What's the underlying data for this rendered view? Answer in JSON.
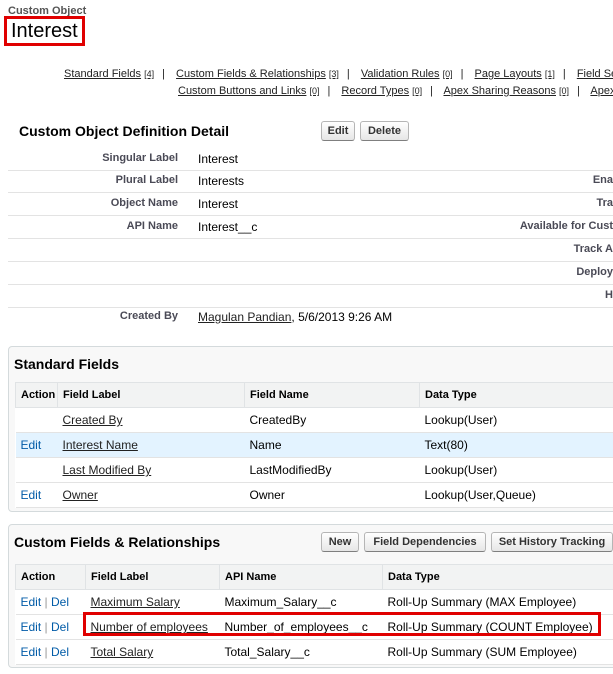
{
  "header": {
    "object_type": "Custom Object",
    "object_name": "Interest"
  },
  "related_links": {
    "row1": [
      {
        "label": "Standard Fields",
        "count": "[4]"
      },
      {
        "label": "Custom Fields & Relationships",
        "count": "[3]"
      },
      {
        "label": "Validation Rules",
        "count": "[0]"
      },
      {
        "label": "Page Layouts",
        "count": "[1]"
      },
      {
        "label": "Field Sets",
        "count": ""
      }
    ],
    "row2": [
      {
        "label": "Custom Buttons and Links",
        "count": "[0]"
      },
      {
        "label": "Record Types",
        "count": "[0]"
      },
      {
        "label": "Apex Sharing Reasons",
        "count": "[0]"
      },
      {
        "label": "Apex",
        "count": ""
      }
    ]
  },
  "definition": {
    "title": "Custom Object Definition Detail",
    "edit_label": "Edit",
    "delete_label": "Delete",
    "rows": [
      {
        "label": "Singular Label",
        "value": "Interest",
        "right_label": ""
      },
      {
        "label": "Plural Label",
        "value": "Interests",
        "right_label": "Ena"
      },
      {
        "label": "Object Name",
        "value": "Interest",
        "right_label": "Tra"
      },
      {
        "label": "API Name",
        "value": "Interest__c",
        "right_label": "Available for Cust"
      },
      {
        "label": "",
        "value": "",
        "right_label": "Track A"
      },
      {
        "label": "",
        "value": "",
        "right_label": "Deploy"
      },
      {
        "label": "",
        "value": "",
        "right_label": "H"
      }
    ],
    "created_by": {
      "label": "Created By",
      "user": "Magulan Pandian",
      "date": ", 5/6/2013 9:26 AM"
    }
  },
  "standard_fields": {
    "title": "Standard Fields",
    "columns": [
      "Action",
      "Field Label",
      "Field Name",
      "Data Type"
    ],
    "rows": [
      {
        "action": "",
        "field_label": "Created By",
        "field_name": "CreatedBy",
        "data_type": "Lookup(User)"
      },
      {
        "action": "Edit",
        "field_label": "Interest Name",
        "field_name": "Name",
        "data_type": "Text(80)"
      },
      {
        "action": "",
        "field_label": "Last Modified By",
        "field_name": "LastModifiedBy",
        "data_type": "Lookup(User)"
      },
      {
        "action": "Edit",
        "field_label": "Owner",
        "field_name": "Owner",
        "data_type": "Lookup(User,Queue)"
      }
    ]
  },
  "custom_fields": {
    "title": "Custom Fields & Relationships",
    "buttons": {
      "new": "New",
      "field_dependencies": "Field Dependencies",
      "history": "Set History Tracking"
    },
    "columns": [
      "Action",
      "Field Label",
      "API Name",
      "Data Type"
    ],
    "action_edit": "Edit",
    "action_sep": "|",
    "action_del": "Del",
    "rows": [
      {
        "field_label": "Maximum Salary",
        "api_name": "Maximum_Salary__c",
        "data_type": "Roll-Up Summary (MAX Employee)"
      },
      {
        "field_label": "Number of employees",
        "api_name": "Number_of_employees__c",
        "data_type": "Roll-Up Summary (COUNT Employee)"
      },
      {
        "field_label": "Total Salary",
        "api_name": "Total_Salary__c",
        "data_type": "Roll-Up Summary (SUM Employee)"
      }
    ]
  },
  "colors": {
    "highlight_border": "#e00000",
    "link": "#015ba7",
    "row_hover": "#e3f3ff"
  }
}
